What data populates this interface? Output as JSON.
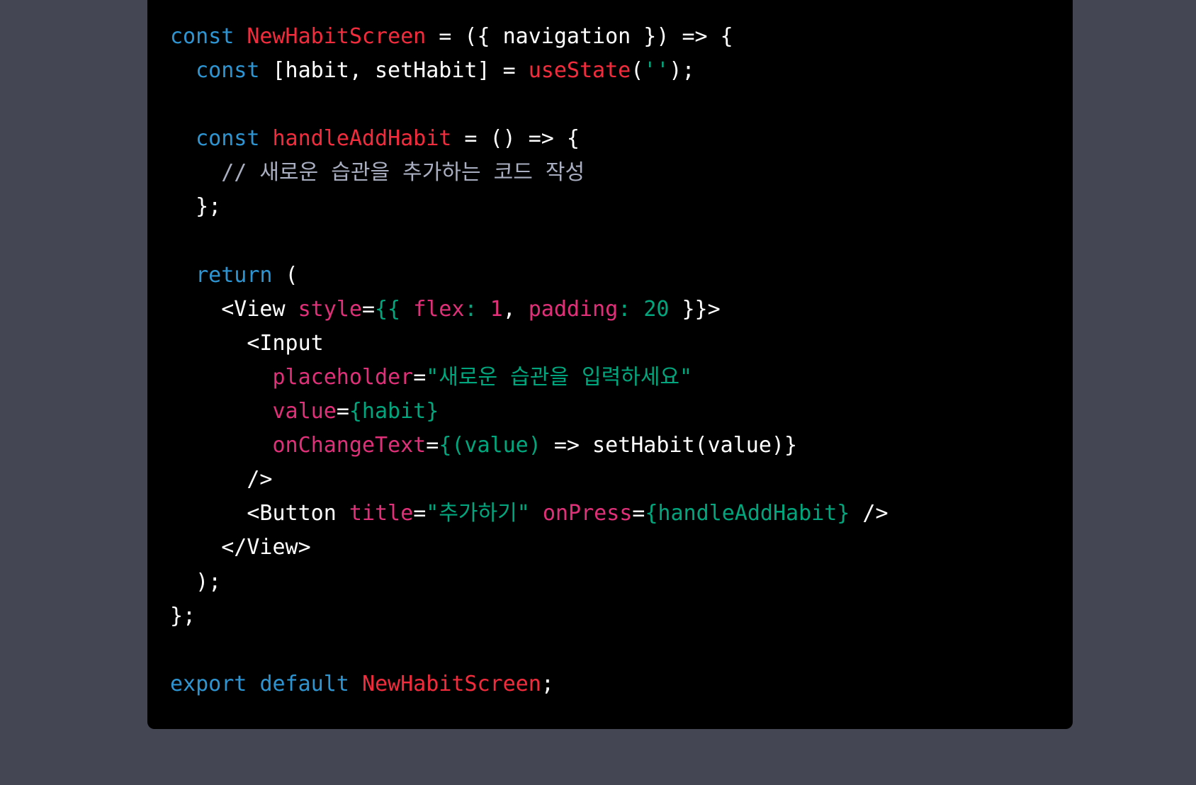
{
  "colors": {
    "page_background": "#444654",
    "code_background": "#000000",
    "plain": "#ffffff",
    "keyword": "#2e95d3",
    "name": "#df3079",
    "title": "#f22c3d",
    "string": "#00a67d",
    "comment": "#a9aec1"
  },
  "code": {
    "lines": [
      [
        {
          "t": "const",
          "k": "keyword"
        },
        {
          "t": " ",
          "k": "plain"
        },
        {
          "t": "NewHabitScreen",
          "k": "title"
        },
        {
          "t": " = ({ navigation }) => {",
          "k": "plain"
        }
      ],
      [
        {
          "t": "  ",
          "k": "plain"
        },
        {
          "t": "const",
          "k": "keyword"
        },
        {
          "t": " [habit, setHabit] = ",
          "k": "plain"
        },
        {
          "t": "useState",
          "k": "title"
        },
        {
          "t": "(",
          "k": "plain"
        },
        {
          "t": "''",
          "k": "string"
        },
        {
          "t": ");",
          "k": "plain"
        }
      ],
      [],
      [
        {
          "t": "  ",
          "k": "plain"
        },
        {
          "t": "const",
          "k": "keyword"
        },
        {
          "t": " ",
          "k": "plain"
        },
        {
          "t": "handleAddHabit",
          "k": "title"
        },
        {
          "t": " = () => {",
          "k": "plain"
        }
      ],
      [
        {
          "t": "    ",
          "k": "plain"
        },
        {
          "t": "// 새로운 습관을 추가하는 코드 작성",
          "k": "comment"
        }
      ],
      [
        {
          "t": "  };",
          "k": "plain"
        }
      ],
      [],
      [
        {
          "t": "  ",
          "k": "plain"
        },
        {
          "t": "return",
          "k": "keyword"
        },
        {
          "t": " (",
          "k": "plain"
        }
      ],
      [
        {
          "t": "    <View ",
          "k": "plain"
        },
        {
          "t": "style",
          "k": "name"
        },
        {
          "t": "=",
          "k": "plain"
        },
        {
          "t": "{{ ",
          "k": "string"
        },
        {
          "t": "flex",
          "k": "name"
        },
        {
          "t": ": ",
          "k": "string"
        },
        {
          "t": "1",
          "k": "name"
        },
        {
          "t": ", ",
          "k": "plain"
        },
        {
          "t": "padding",
          "k": "name"
        },
        {
          "t": ": ",
          "k": "string"
        },
        {
          "t": "20",
          "k": "string"
        },
        {
          "t": " }}>",
          "k": "plain"
        }
      ],
      [
        {
          "t": "      <Input",
          "k": "plain"
        }
      ],
      [
        {
          "t": "        ",
          "k": "plain"
        },
        {
          "t": "placeholder",
          "k": "name"
        },
        {
          "t": "=",
          "k": "plain"
        },
        {
          "t": "\"새로운 습관을 입력하세요\"",
          "k": "string"
        }
      ],
      [
        {
          "t": "        ",
          "k": "plain"
        },
        {
          "t": "value",
          "k": "name"
        },
        {
          "t": "=",
          "k": "plain"
        },
        {
          "t": "{habit}",
          "k": "string"
        }
      ],
      [
        {
          "t": "        ",
          "k": "plain"
        },
        {
          "t": "onChangeText",
          "k": "name"
        },
        {
          "t": "=",
          "k": "plain"
        },
        {
          "t": "{(value)",
          "k": "string"
        },
        {
          "t": " => setHabit(value)}",
          "k": "plain"
        }
      ],
      [
        {
          "t": "      />",
          "k": "plain"
        }
      ],
      [
        {
          "t": "      <Button ",
          "k": "plain"
        },
        {
          "t": "title",
          "k": "name"
        },
        {
          "t": "=",
          "k": "plain"
        },
        {
          "t": "\"추가하기\"",
          "k": "string"
        },
        {
          "t": " ",
          "k": "plain"
        },
        {
          "t": "onPress",
          "k": "name"
        },
        {
          "t": "=",
          "k": "plain"
        },
        {
          "t": "{handleAddHabit}",
          "k": "string"
        },
        {
          "t": " />",
          "k": "plain"
        }
      ],
      [
        {
          "t": "    </View>",
          "k": "plain"
        }
      ],
      [
        {
          "t": "  );",
          "k": "plain"
        }
      ],
      [
        {
          "t": "};",
          "k": "plain"
        }
      ],
      [],
      [
        {
          "t": "export",
          "k": "keyword"
        },
        {
          "t": " ",
          "k": "plain"
        },
        {
          "t": "default",
          "k": "keyword"
        },
        {
          "t": " ",
          "k": "plain"
        },
        {
          "t": "NewHabitScreen",
          "k": "title"
        },
        {
          "t": ";",
          "k": "plain"
        }
      ]
    ]
  }
}
